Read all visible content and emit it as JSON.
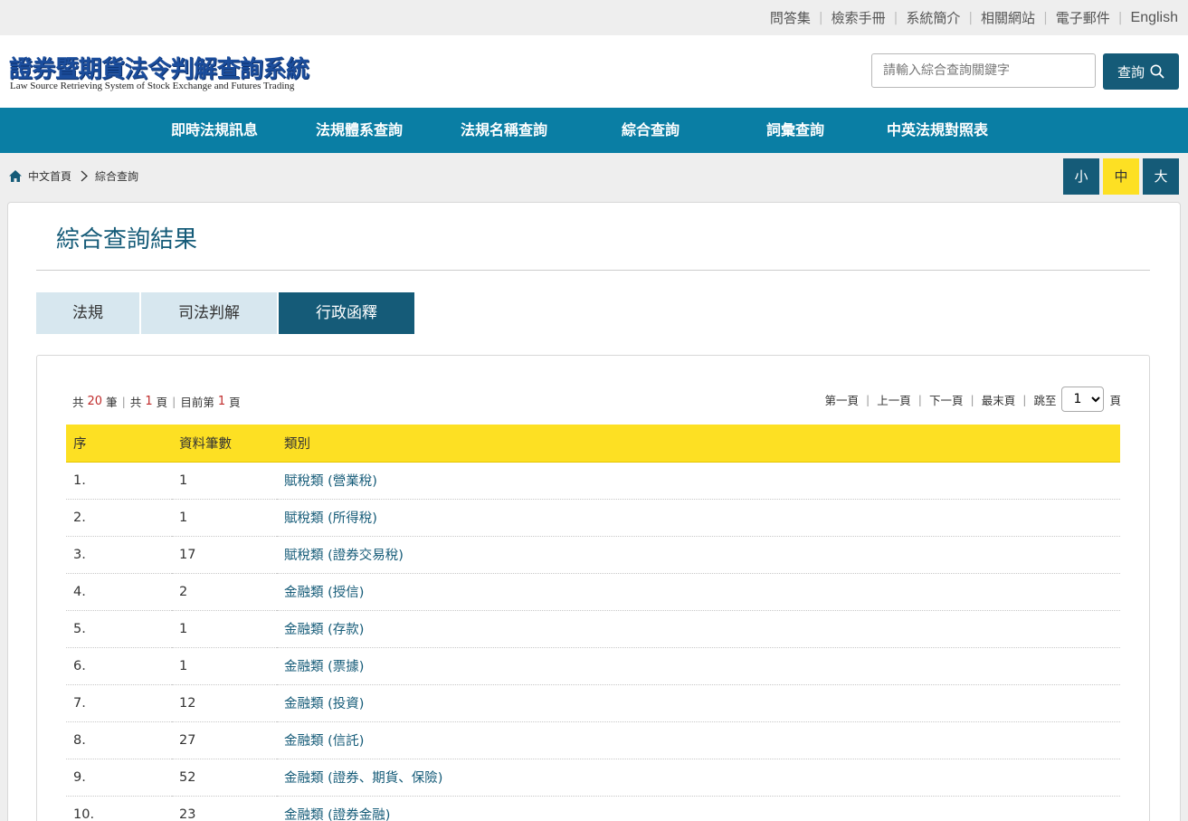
{
  "toplinks": [
    "問答集",
    "檢索手冊",
    "系統簡介",
    "相關網站",
    "電子郵件",
    "English"
  ],
  "logo": {
    "zh": "證券暨期貨法令判解查詢系統",
    "en": "Law Source Retrieving System of Stock Exchange and Futures Trading"
  },
  "search": {
    "placeholder": "請輸入綜合查詢關鍵字",
    "button": "查詢",
    "icon": "search-icon"
  },
  "nav": [
    "即時法規訊息",
    "法規體系查詢",
    "法規名稱查詢",
    "綜合查詢",
    "詞彙查詢",
    "中英法規對照表"
  ],
  "breadcrumb": {
    "home": "中文首頁",
    "current": "綜合查詢",
    "home_icon": "home-icon"
  },
  "font_size": {
    "small": "小",
    "medium": "中",
    "large": "大",
    "active": "medium"
  },
  "page_title": "綜合查詢結果",
  "tabs": [
    {
      "label": "法規",
      "active": false
    },
    {
      "label": "司法判解",
      "active": false
    },
    {
      "label": "行政函釋",
      "active": true
    }
  ],
  "summary": {
    "total_prefix": "共",
    "total": "20",
    "total_suffix": "筆",
    "pages_prefix": "共",
    "pages": "1",
    "pages_suffix": "頁",
    "current_prefix": "目前第",
    "current": "1",
    "current_suffix": "頁"
  },
  "pager": {
    "first": "第一頁",
    "prev": "上一頁",
    "next": "下一頁",
    "last": "最末頁",
    "jump": "跳至",
    "page_value": "1",
    "page_suffix": "頁"
  },
  "table": {
    "headers": [
      "序",
      "資料筆數",
      "類別"
    ],
    "rows": [
      [
        "1.",
        "1",
        "賦稅類 (營業稅)"
      ],
      [
        "2.",
        "1",
        "賦稅類 (所得稅)"
      ],
      [
        "3.",
        "17",
        "賦稅類 (證券交易稅)"
      ],
      [
        "4.",
        "2",
        "金融類 (授信)"
      ],
      [
        "5.",
        "1",
        "金融類 (存款)"
      ],
      [
        "6.",
        "1",
        "金融類 (票據)"
      ],
      [
        "7.",
        "12",
        "金融類 (投資)"
      ],
      [
        "8.",
        "27",
        "金融類 (信託)"
      ],
      [
        "9.",
        "52",
        "金融類 (證券、期貨、保險)"
      ],
      [
        "10.",
        "23",
        "金融類 (證券金融)"
      ]
    ]
  },
  "colors": {
    "primary": "#155b78",
    "nav": "#0a7ea4",
    "accent": "#fde023",
    "count": "#c02c2c"
  }
}
